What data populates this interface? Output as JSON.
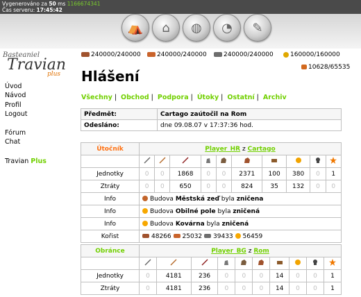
{
  "server": {
    "generated_label": "Vygenerováno za",
    "generated_ms": "50",
    "ms_unit": "ms",
    "ms_extra": "1166674341",
    "time_label": "Čas serveru:",
    "time_value": "17:45:42"
  },
  "logo": {
    "line1": "Basteaniel",
    "line2": "Travian",
    "line3": "plus"
  },
  "sidebar": {
    "items": [
      "Úvod",
      "Návod",
      "Profil",
      "Logout"
    ],
    "items2": [
      "Fórum",
      "Chat"
    ],
    "plus_prefix": "Travian",
    "plus_suffix": "Plus"
  },
  "resources": {
    "wood": "240000/240000",
    "clay": "240000/240000",
    "iron": "240000/240000",
    "crop": "160000/160000",
    "consumption": "10628/65535"
  },
  "colors": {
    "accent_green": "#71d000",
    "attacker_orange": "#ff6f0f"
  },
  "title": "Hlášení",
  "tabs": [
    "Všechny",
    "Obchod",
    "Podpora",
    "Útoky",
    "Ostatní",
    "Archiv"
  ],
  "header": {
    "subject_label": "Předmět:",
    "subject_value": "Cartago zaútočil na Rom",
    "sent_label": "Odesláno:",
    "sent_value": "dne 09.08.07 v 17:37:36 hod."
  },
  "attacker": {
    "role": "Útočník",
    "player": "Player_HR",
    "from": "z",
    "village": "Cartago",
    "units_label": "Jednotky",
    "units": [
      "0",
      "0",
      "1868",
      "0",
      "0",
      "2371",
      "100",
      "380",
      "0",
      "1"
    ],
    "losses_label": "Ztráty",
    "losses": [
      "0",
      "0",
      "650",
      "0",
      "0",
      "824",
      "35",
      "132",
      "0",
      "0"
    ],
    "info_label": "Info",
    "info": [
      {
        "prefix": "Budova",
        "name": "Městská zeď",
        "mid": "byla",
        "result": "zničena"
      },
      {
        "prefix": "Budova",
        "name": "Obilné pole",
        "mid": "byla",
        "result": "zničená"
      },
      {
        "prefix": "Budova",
        "name": "Kovárna",
        "mid": "byla",
        "result": "zničená"
      }
    ],
    "bounty_label": "Kořist",
    "bounty": [
      "48266",
      "25032",
      "39433",
      "56459"
    ]
  },
  "defender": {
    "role": "Obránce",
    "player": "Player_BG",
    "from": "z",
    "village": "Rom",
    "units_label": "Jednotky",
    "units": [
      "0",
      "4181",
      "236",
      "0",
      "0",
      "0",
      "14",
      "0",
      "0",
      "1"
    ],
    "losses_label": "Ztráty",
    "losses": [
      "0",
      "4181",
      "236",
      "0",
      "0",
      "0",
      "14",
      "0",
      "0",
      "1"
    ]
  }
}
